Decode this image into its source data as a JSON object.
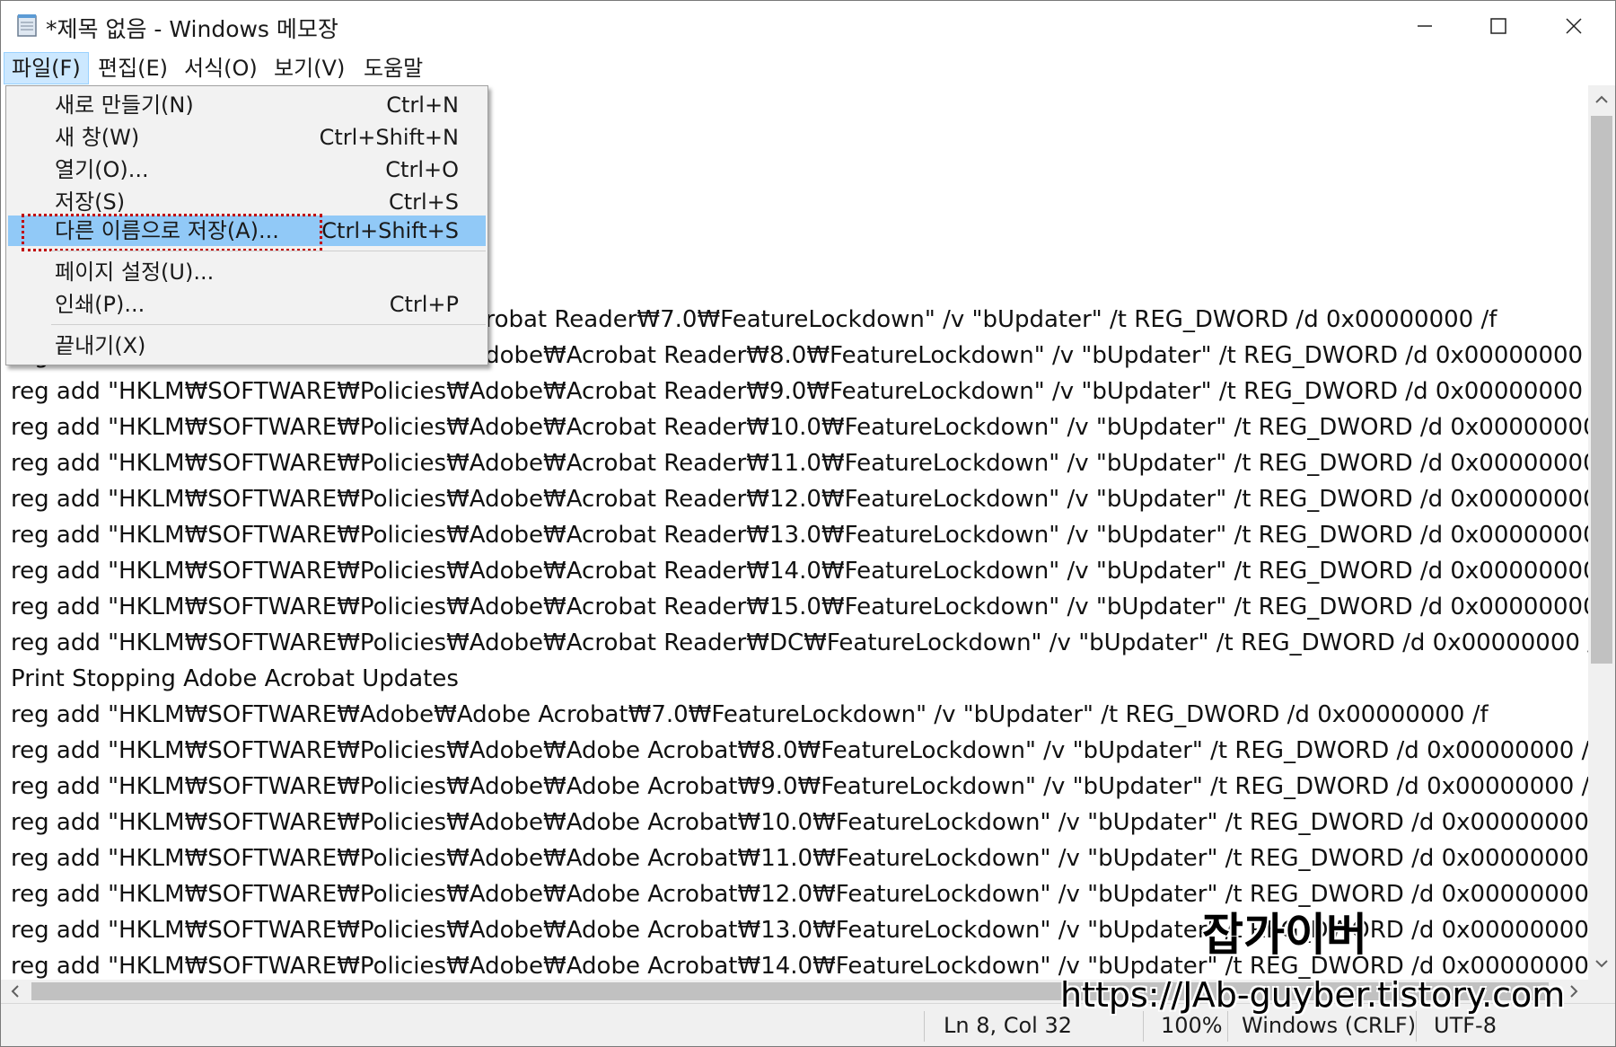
{
  "window": {
    "title": "*제목 없음 - Windows 메모장",
    "icon": "notepad-icon"
  },
  "menubar": [
    "파일(F)",
    "편집(E)",
    "서식(O)",
    "보기(V)",
    "도움말"
  ],
  "file_menu": {
    "items": [
      {
        "label": "새로 만들기(N)",
        "shortcut": "Ctrl+N"
      },
      {
        "label": "새 창(W)",
        "shortcut": "Ctrl+Shift+N"
      },
      {
        "label": "열기(O)...",
        "shortcut": "Ctrl+O"
      },
      {
        "label": "저장(S)",
        "shortcut": "Ctrl+S"
      },
      {
        "label": "다른 이름으로 저장(A)...",
        "shortcut": "Ctrl+Shift+S",
        "highlighted": true
      },
      {
        "label": "페이지 설정(U)...",
        "shortcut": ""
      },
      {
        "label": "인쇄(P)...",
        "shortcut": "Ctrl+P"
      },
      {
        "label": "끝내기(X)",
        "shortcut": ""
      }
    ]
  },
  "editor": {
    "lines": [
      "reg add \"HKLM₩SOFTWARE₩Adobe₩Acrobat Reader₩7.0₩FeatureLockdown\" /v \"bUpdater\" /t REG_DWORD /d 0x00000000 /f",
      "reg add \"HKLM₩SOFTWARE₩Policies₩Adobe₩Acrobat Reader₩8.0₩FeatureLockdown\" /v \"bUpdater\" /t REG_DWORD /d 0x00000000 /",
      "reg add \"HKLM₩SOFTWARE₩Policies₩Adobe₩Acrobat Reader₩9.0₩FeatureLockdown\" /v \"bUpdater\" /t REG_DWORD /d 0x00000000 /",
      "reg add \"HKLM₩SOFTWARE₩Policies₩Adobe₩Acrobat Reader₩10.0₩FeatureLockdown\" /v \"bUpdater\" /t REG_DWORD /d 0x00000000",
      "reg add \"HKLM₩SOFTWARE₩Policies₩Adobe₩Acrobat Reader₩11.0₩FeatureLockdown\" /v \"bUpdater\" /t REG_DWORD /d 0x00000000",
      "reg add \"HKLM₩SOFTWARE₩Policies₩Adobe₩Acrobat Reader₩12.0₩FeatureLockdown\" /v \"bUpdater\" /t REG_DWORD /d 0x00000000",
      "reg add \"HKLM₩SOFTWARE₩Policies₩Adobe₩Acrobat Reader₩13.0₩FeatureLockdown\" /v \"bUpdater\" /t REG_DWORD /d 0x00000000",
      "reg add \"HKLM₩SOFTWARE₩Policies₩Adobe₩Acrobat Reader₩14.0₩FeatureLockdown\" /v \"bUpdater\" /t REG_DWORD /d 0x00000000",
      "reg add \"HKLM₩SOFTWARE₩Policies₩Adobe₩Acrobat Reader₩15.0₩FeatureLockdown\" /v \"bUpdater\" /t REG_DWORD /d 0x00000000",
      "reg add \"HKLM₩SOFTWARE₩Policies₩Adobe₩Acrobat Reader₩DC₩FeatureLockdown\" /v \"bUpdater\" /t REG_DWORD /d 0x00000000 /",
      "Print Stopping Adobe Acrobat Updates",
      "reg add \"HKLM₩SOFTWARE₩Adobe₩Adobe Acrobat₩7.0₩FeatureLockdown\" /v \"bUpdater\" /t REG_DWORD /d 0x00000000 /f",
      "reg add \"HKLM₩SOFTWARE₩Policies₩Adobe₩Adobe Acrobat₩8.0₩FeatureLockdown\" /v \"bUpdater\" /t REG_DWORD /d 0x00000000 /",
      "reg add \"HKLM₩SOFTWARE₩Policies₩Adobe₩Adobe Acrobat₩9.0₩FeatureLockdown\" /v \"bUpdater\" /t REG_DWORD /d 0x00000000 /",
      "reg add \"HKLM₩SOFTWARE₩Policies₩Adobe₩Adobe Acrobat₩10.0₩FeatureLockdown\" /v \"bUpdater\" /t REG_DWORD /d 0x00000000",
      "reg add \"HKLM₩SOFTWARE₩Policies₩Adobe₩Adobe Acrobat₩11.0₩FeatureLockdown\" /v \"bUpdater\" /t REG_DWORD /d 0x00000000",
      "reg add \"HKLM₩SOFTWARE₩Policies₩Adobe₩Adobe Acrobat₩12.0₩FeatureLockdown\" /v \"bUpdater\" /t REG_DWORD /d 0x00000000",
      "reg add \"HKLM₩SOFTWARE₩Policies₩Adobe₩Adobe Acrobat₩13.0₩FeatureLockdown\" /v \"bUpdater\" /t REG_DWORD /d 0x00000000",
      "reg add \"HKLM₩SOFTWARE₩Policies₩Adobe₩Adobe Acrobat₩14.0₩FeatureLockdown\" /v \"bUpdater\" /t REG_DWORD /d 0x00000000"
    ]
  },
  "statusbar": {
    "position": "Ln 8, Col 32",
    "zoom": "100%",
    "line_ending": "Windows (CRLF)",
    "encoding": "UTF-8"
  },
  "watermark": {
    "name": "잡가이버",
    "url": "https://JAb-guyber.tistory.com"
  },
  "colors": {
    "menu_highlight": "#91c9f7",
    "active_menu": "#cce8ff",
    "focus_marker": "#c00000"
  }
}
